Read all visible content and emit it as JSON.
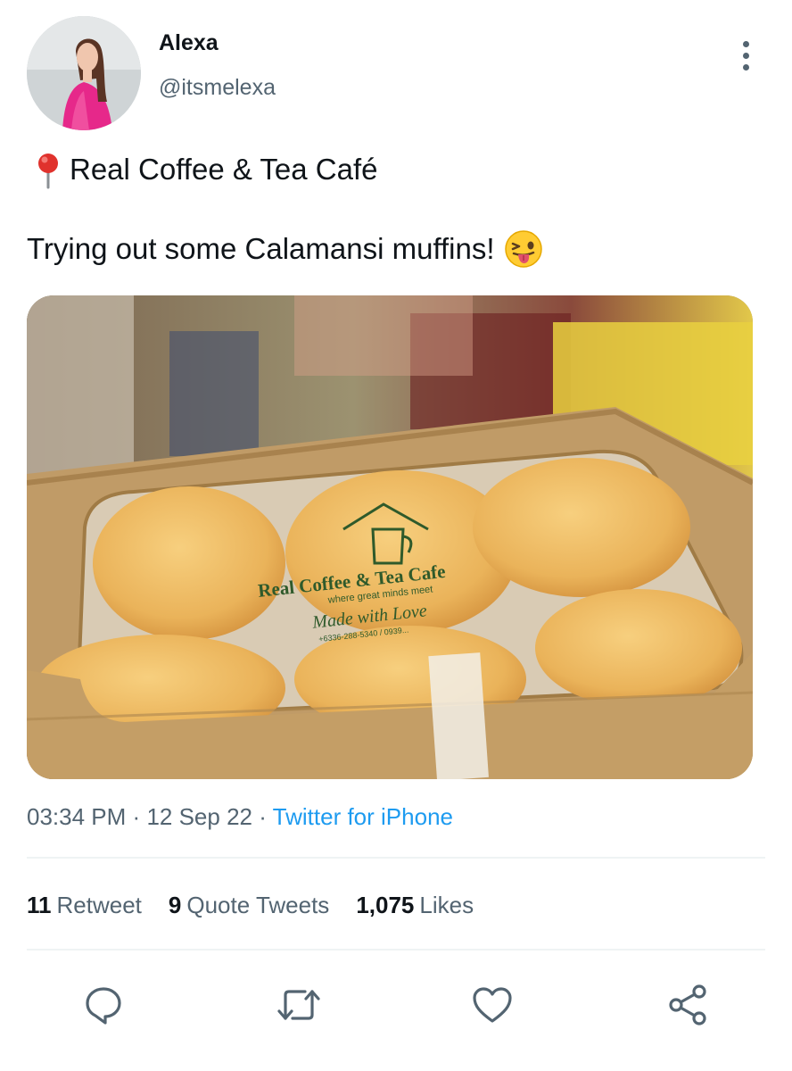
{
  "tweet": {
    "author": {
      "display_name": "Alexa",
      "handle": "@itsmelexa",
      "avatar_icon": "profile-photo"
    },
    "location_icon": "round-pushpin-icon",
    "location_text": "Real Coffee & Tea Café",
    "text": "Trying out some Calamansi muffins!",
    "emoji": "winking-face-with-tongue-emoji",
    "media": {
      "description_icon": "photo",
      "muffin_text": {
        "brand": "Real Coffee & Tea Cafe",
        "tagline": "where great minds meet",
        "script": "Made with Love",
        "phone": "+6336-288-5340 / 0939..."
      }
    },
    "time": "03:34 PM",
    "date": "12 Sep 22",
    "separator": "·",
    "source": "Twitter for iPhone"
  },
  "stats": {
    "retweets_count": "11",
    "retweets_label": "Retweet",
    "quotes_count": "9",
    "quotes_label": "Quote Tweets",
    "likes_count": "1,075",
    "likes_label": "Likes"
  },
  "colors": {
    "primary_text": "#0f1419",
    "secondary_text": "#536471",
    "link": "#1d9bf0",
    "divider": "#eff3f4"
  }
}
